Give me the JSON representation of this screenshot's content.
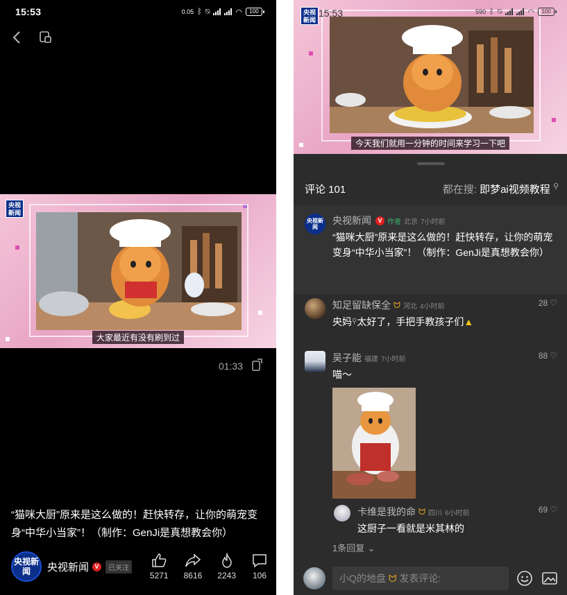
{
  "left": {
    "status": {
      "time": "15:53",
      "net_speed": "0.05",
      "battery": "100"
    },
    "video": {
      "logo": "央视新闻",
      "subtitle": "大家最近有没有刷到过"
    },
    "duration": "01:33",
    "caption": "“猫咪大厨”原来是这么做的！赶快转存，让你的萌宠变身“中华小当家”！（制作：GenJi是真想教会你）",
    "author": {
      "name": "央视新闻",
      "avatar_text": "央视新闻",
      "verified": "V",
      "follow_status": "已关注"
    },
    "actions": [
      {
        "icon": "thumbs-up-icon",
        "count": "5271"
      },
      {
        "icon": "share-arrow-icon",
        "count": "8616"
      },
      {
        "icon": "flame-icon",
        "count": "2243"
      },
      {
        "icon": "comment-bubble-icon",
        "count": "106"
      }
    ]
  },
  "right": {
    "status": {
      "time": "15:53",
      "net_speed": "590"
    },
    "video": {
      "logo": "央视新闻",
      "subtitle": "今天我们就用一分钟的时间来学习一下吧"
    },
    "comments_header": {
      "title": "评论 101",
      "search_prefix": "都在搜:",
      "search_term": "即梦ai视频教程"
    },
    "comments": [
      {
        "name": "央视新闻",
        "verified": "V",
        "tag": "作者",
        "location": "北京",
        "time": "7小时前",
        "text": "“猫咪大厨”原来是这么做的！赶快转存，让你的萌宠变身“中华小当家”！（制作：GenJi是真想教会你）"
      },
      {
        "name": "知足留缺保全",
        "badge": "ᗢ",
        "location": "河北",
        "time": "4小时前",
        "text": "央妈",
        "text_after": "太好了，手把手教孩子们",
        "likes": "28"
      },
      {
        "name": "吴子能",
        "location": "福建",
        "time": "7小时前",
        "text": "喵～",
        "likes": "88"
      }
    ],
    "reply": {
      "name": "卡维是我的命",
      "location": "四川",
      "time": "6小时前",
      "text": "这厨子一看就是米其林的",
      "likes": "69"
    },
    "more_replies": "1条回复",
    "input": {
      "placeholder_name": "小Q的地盘",
      "placeholder": "发表评论:"
    },
    "accent_pink": "#e8a5c4",
    "accent_blue": "#0b2f8a"
  }
}
